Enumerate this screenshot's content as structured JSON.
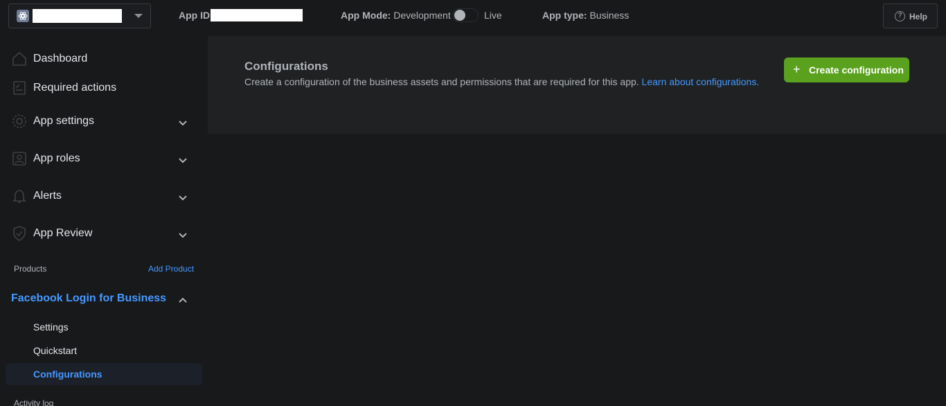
{
  "topbar": {
    "app_id_label": "App ID:",
    "app_mode_label": "App Mode:",
    "app_mode_value": "Development",
    "live_label": "Live",
    "app_type_label": "App type:",
    "app_type_value": "Business",
    "help_label": "Help",
    "help_icon_glyph": "?"
  },
  "sidebar": {
    "items": [
      {
        "label": "Dashboard",
        "icon": "home-icon"
      },
      {
        "label": "Required actions",
        "icon": "checklist-icon"
      },
      {
        "label": "App settings",
        "icon": "gear-icon"
      },
      {
        "label": "App roles",
        "icon": "user-badge-icon"
      },
      {
        "label": "Alerts",
        "icon": "bell-icon"
      },
      {
        "label": "App Review",
        "icon": "shield-check-icon"
      }
    ],
    "products_label": "Products",
    "add_product_label": "Add Product",
    "product_name": "Facebook Login for Business",
    "sub_items": [
      "Settings",
      "Quickstart",
      "Configurations"
    ],
    "activity_label": "Activity log"
  },
  "main": {
    "title": "Configurations",
    "description": "Create a configuration of the business assets and permissions that are required for this app.",
    "link_text": "Learn about configurations.",
    "create_button_label": "Create configuration",
    "create_button_glyph": "+"
  },
  "colors": {
    "background": "#18191b",
    "panel": "#1f2123",
    "accent_blue": "#4599ff",
    "button_green": "#5aa11d"
  }
}
